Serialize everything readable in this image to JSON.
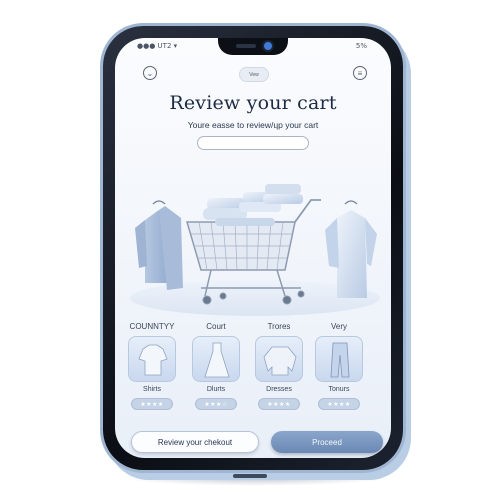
{
  "status": {
    "left": "●●● UT2 ▾",
    "right": "5%"
  },
  "header": {
    "tag": "Vew",
    "title": "Review your cart",
    "subtitle": "Youre easse to review/ɥp your cart"
  },
  "icons": {
    "back": "chevron-down-icon",
    "menu": "menu-icon"
  },
  "categories": [
    "COUNNTYY",
    "Court",
    "Trores",
    "Very"
  ],
  "products": [
    {
      "label": "Shirts",
      "stars": "★★★★"
    },
    {
      "label": "Dlurts",
      "stars": "★★★☆"
    },
    {
      "label": "Dresses",
      "stars": "★★★★"
    },
    {
      "label": "Tonurs",
      "stars": "★★★★"
    }
  ],
  "buttons": {
    "checkout": "Review your chekout",
    "proceed": "Proceed"
  },
  "colors": {
    "accent": "#6b88b3",
    "title": "#1d2a44",
    "card": "#c9d8ee"
  }
}
